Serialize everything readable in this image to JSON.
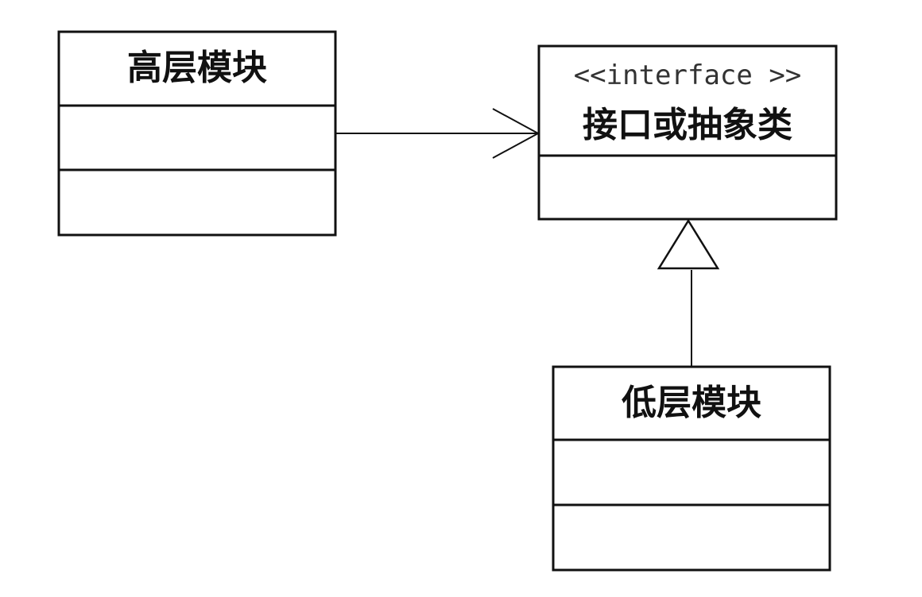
{
  "high_module": {
    "title": "高层模块"
  },
  "interface": {
    "stereotype": "<<interface >>",
    "title": "接口或抽象类"
  },
  "low_module": {
    "title": "低层模块"
  },
  "relations": [
    {
      "from": "高层模块",
      "to": "接口或抽象类",
      "kind": "dependency"
    },
    {
      "from": "低层模块",
      "to": "接口或抽象类",
      "kind": "realization"
    }
  ]
}
